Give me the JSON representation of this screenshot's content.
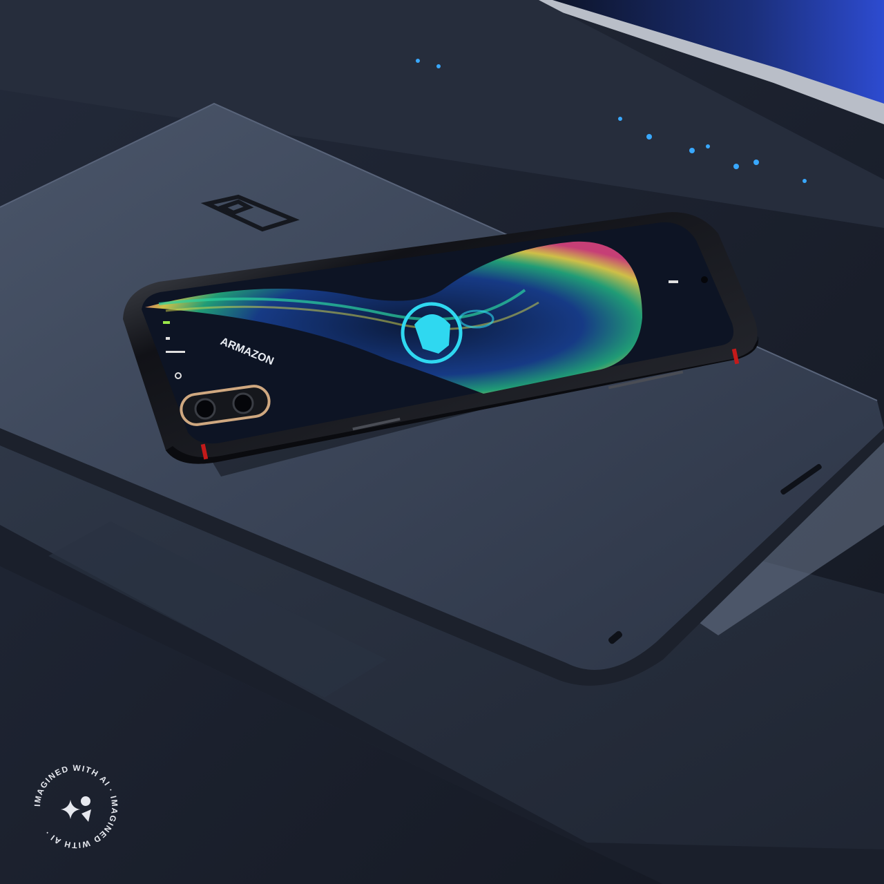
{
  "phone": {
    "screen_text": "ARMAZON",
    "status_icon_label": "..."
  },
  "watermark": {
    "ring_text": "IMAGINED WITH AI · IMAGINED WITH AI ·",
    "icon": "sparkle-icon"
  },
  "colors": {
    "background": "#1b2130",
    "laptop_lid": "#3c475c",
    "phone_frame": "#0c0d12",
    "accent_red": "#c41a1a",
    "cyan_logo": "#2fd8f0",
    "led_blue": "#39a8ff"
  },
  "icons": [
    "laptop-logo-icon",
    "phone-camera-icon",
    "headphone-avatar-icon",
    "sparkle-icon"
  ]
}
